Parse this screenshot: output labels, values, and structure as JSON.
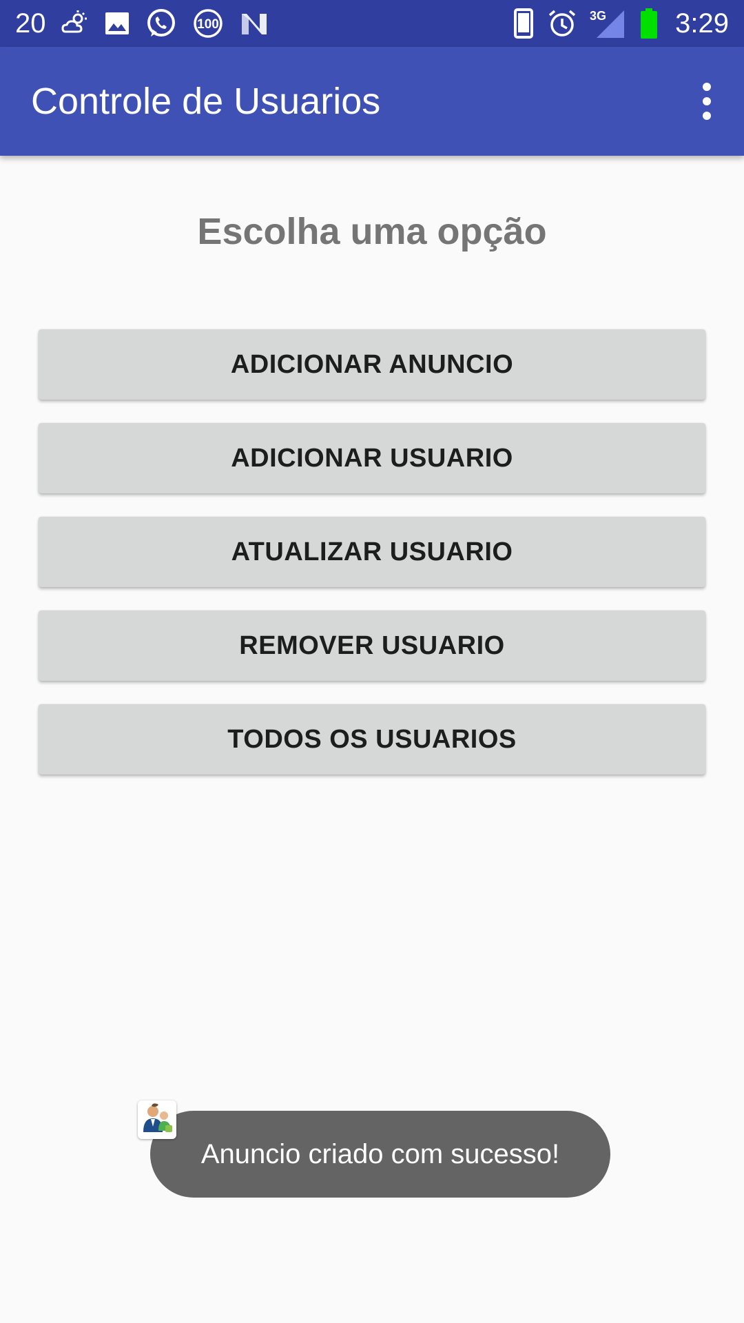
{
  "status_bar": {
    "left_number": "20",
    "notification_icons": [
      "weather-icon",
      "image-icon",
      "whatsapp-icon",
      "badge-100-icon",
      "n-icon"
    ],
    "badge_text": "100",
    "network_label": "3G",
    "time": "3:29",
    "battery_color": "#00e000"
  },
  "app_bar": {
    "title": "Controle de Usuarios",
    "menu_icon": "overflow-menu-icon"
  },
  "main": {
    "heading": "Escolha uma opção",
    "buttons": [
      "ADICIONAR ANUNCIO",
      "ADICIONAR USUARIO",
      "ATUALIZAR USUARIO",
      "REMOVER USUARIO",
      "TODOS OS USUARIOS"
    ]
  },
  "toast": {
    "message": "Anuncio criado com sucesso!",
    "app_icon": "app-users-icon"
  },
  "colors": {
    "status_bar": "#303f9f",
    "app_bar": "#3f51b5",
    "button_bg": "#d6d7d7",
    "toast_bg": "#646464"
  }
}
